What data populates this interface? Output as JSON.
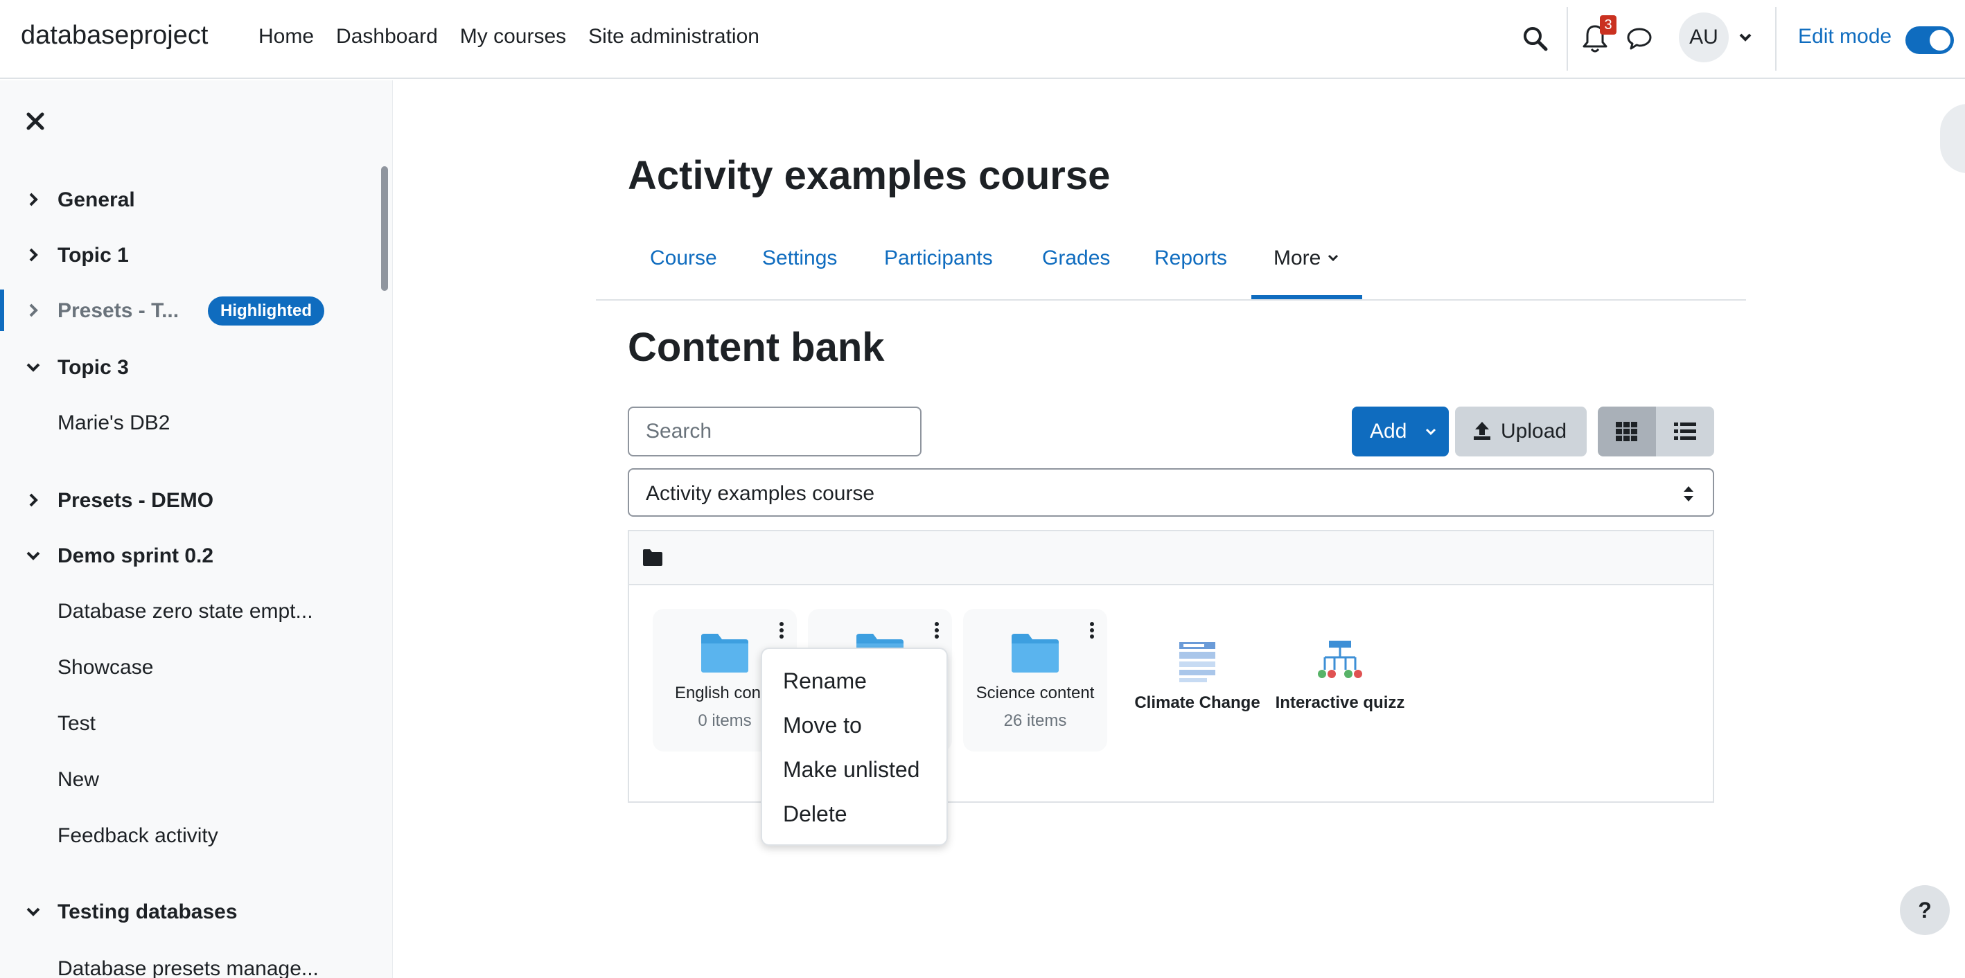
{
  "navbar": {
    "brand": "databaseproject",
    "links": [
      "Home",
      "Dashboard",
      "My courses",
      "Site administration"
    ],
    "notification_count": "3",
    "avatar_initials": "AU",
    "edit_mode_label": "Edit mode",
    "edit_mode_on": true
  },
  "drawer": {
    "sections": [
      {
        "label": "General",
        "expanded": false
      },
      {
        "label": "Topic 1",
        "expanded": false
      },
      {
        "label": "Presets - T...",
        "expanded": false,
        "badge": "Highlighted"
      },
      {
        "label": "Topic 3",
        "expanded": true
      },
      {
        "label": "Presets - DEMO",
        "expanded": false
      },
      {
        "label": "Demo sprint 0.2",
        "expanded": true
      },
      {
        "label": "Testing databases",
        "expanded": true
      }
    ],
    "topic3_items": [
      "Marie's DB2"
    ],
    "demo_items": [
      "Database zero state empt...",
      "Showcase",
      "Test",
      "New",
      "Feedback activity"
    ],
    "testing_items": [
      "Database presets manage..."
    ]
  },
  "course": {
    "title": "Activity examples course",
    "tabs": [
      "Course",
      "Settings",
      "Participants",
      "Grades",
      "Reports",
      "More"
    ],
    "active_tab": "More"
  },
  "content_bank": {
    "title": "Content bank",
    "search_placeholder": "Search",
    "add_label": "Add",
    "upload_label": "Upload",
    "context_selected": "Activity examples course",
    "folders": [
      {
        "name": "English conte",
        "count": "0 items"
      },
      {
        "name": "",
        "count": ""
      },
      {
        "name": "Science content",
        "count": "26 items"
      }
    ],
    "files": [
      {
        "name": "Climate Change"
      },
      {
        "name": "Interactive quizz"
      }
    ],
    "context_menu": [
      "Rename",
      "Move to",
      "Make unlisted",
      "Delete"
    ]
  },
  "help_label": "?",
  "colors": {
    "primary": "#0f6cbf",
    "folder": "#5ab4ee",
    "badge_red": "#ca3120"
  }
}
